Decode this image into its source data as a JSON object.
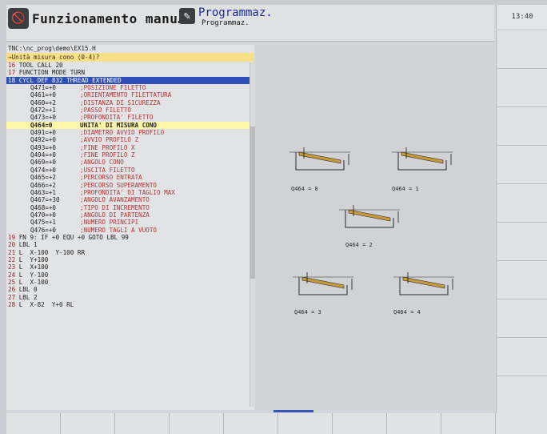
{
  "header": {
    "mode1_label": "Funzionamento manu…",
    "mode2_label": "Programmaz.",
    "mode2_sublabel": "Programmaz.",
    "clock": "13:40"
  },
  "editor": {
    "path": "TNC:\\nc_prog\\demo\\EX15.H",
    "prompt": "→Unità misura cono (0-4)?",
    "lines_before": [
      {
        "num": "16",
        "text": " TOOL CALL 20"
      },
      {
        "num": "17",
        "text": " FUNCTION MODE TURN"
      },
      {
        "num": "18",
        "text": " CYCL DEF 832 THREAD EXTENDED"
      }
    ],
    "params": [
      {
        "name": "Q471=+0",
        "comment": ";POSIZIONE FILETTO"
      },
      {
        "name": "Q461=+0",
        "comment": ";ORIENTAMENTO FILETTATURA"
      },
      {
        "name": "Q460=+2",
        "comment": ";DISTANZA DI SICUREZZA"
      },
      {
        "name": "Q472=+1",
        "comment": ";PASSO FILETTO"
      },
      {
        "name": "Q473=+0",
        "comment": ";PROFONDITA' FILETTO"
      },
      {
        "name": "Q464=0",
        "comment": "UNITA' DI MISURA CONO"
      },
      {
        "name": "Q491=+0",
        "comment": ";DIAMETRO AVVIO PROFILO"
      },
      {
        "name": "Q492=+0",
        "comment": ";AVVIO PROFILO Z"
      },
      {
        "name": "Q493=+0",
        "comment": ";FINE PROFILO X"
      },
      {
        "name": "Q494=+0",
        "comment": ";FINE PROFILO Z"
      },
      {
        "name": "Q469=+0",
        "comment": ";ANGOLO CONO"
      },
      {
        "name": "Q474=+0",
        "comment": ";USCITA FILETTO"
      },
      {
        "name": "Q465=+2",
        "comment": ";PERCORSO ENTRATA"
      },
      {
        "name": "Q466=+2",
        "comment": ";PERCORSO SUPERAMENTO"
      },
      {
        "name": "Q463=+1",
        "comment": ";PROFONDITA' DI TAGLIO MAX"
      },
      {
        "name": "Q467=+30",
        "comment": ";ANGOLO AVANZAMENTO"
      },
      {
        "name": "Q468=+0",
        "comment": ";TIPO DI INCREMENTO"
      },
      {
        "name": "Q470=+0",
        "comment": ";ANGOLO DI PARTENZA"
      },
      {
        "name": "Q475=+1",
        "comment": ";NUMERO PRINCIPI"
      },
      {
        "name": "Q476=+0",
        "comment": ";NUMERO TAGLI A VUOTO"
      }
    ],
    "lines_after": [
      {
        "num": "19",
        "text": " FN 9: IF +0 EQU +0 GOTO LBL 99"
      },
      {
        "num": "20",
        "text": " LBL 1"
      },
      {
        "num": "21",
        "text": " L  X-100  Y-100 RR"
      },
      {
        "num": "22",
        "text": " L  Y+100"
      },
      {
        "num": "23",
        "text": " L  X+100"
      },
      {
        "num": "24",
        "text": " L  Y-100"
      },
      {
        "num": "25",
        "text": " L  X-100"
      },
      {
        "num": "26",
        "text": " LBL 0"
      },
      {
        "num": "27",
        "text": " LBL 2"
      },
      {
        "num": "28",
        "text": " L  X-82  Y+0 RL"
      }
    ]
  },
  "graphic": {
    "variant_labels": [
      "Q464 = 0",
      "Q464 = 1",
      "Q464 = 2",
      "Q464 = 3",
      "Q464 = 4"
    ],
    "colors": {
      "thread": "#c99a3b",
      "outline": "#2a2a2a",
      "arrow": "#1a1a1a"
    }
  }
}
